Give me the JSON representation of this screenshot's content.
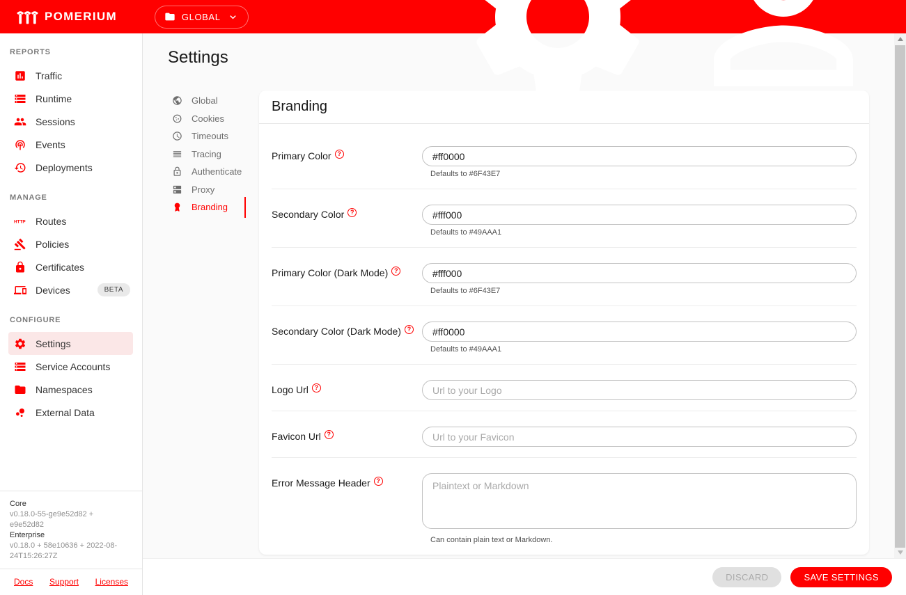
{
  "topbar": {
    "brand": "POMERIUM",
    "scope": {
      "label": "GLOBAL",
      "icon": "folder-icon",
      "chevron": "chevron-down-icon"
    },
    "actions": [
      {
        "name": "console-settings",
        "icon": "gear-icon"
      },
      {
        "name": "account",
        "icon": "person-icon"
      }
    ]
  },
  "colors": {
    "accent": "#ff0000",
    "topbar_bg": "#ff0000",
    "selected_item_bg": "#fbe7e7"
  },
  "sidebar": {
    "sections": [
      {
        "label": "REPORTS",
        "items": [
          {
            "label": "Traffic",
            "icon": "traffic-icon"
          },
          {
            "label": "Runtime",
            "icon": "runtime-icon"
          },
          {
            "label": "Sessions",
            "icon": "sessions-icon"
          },
          {
            "label": "Events",
            "icon": "events-icon"
          },
          {
            "label": "Deployments",
            "icon": "deployments-icon"
          }
        ]
      },
      {
        "label": "MANAGE",
        "items": [
          {
            "label": "Routes",
            "icon": "routes-icon"
          },
          {
            "label": "Policies",
            "icon": "policies-icon"
          },
          {
            "label": "Certificates",
            "icon": "certificates-icon"
          },
          {
            "label": "Devices",
            "icon": "devices-icon",
            "badge": "BETA"
          }
        ]
      },
      {
        "label": "CONFIGURE",
        "items": [
          {
            "label": "Settings",
            "icon": "settings-icon",
            "active": true
          },
          {
            "label": "Service Accounts",
            "icon": "service-accounts-icon"
          },
          {
            "label": "Namespaces",
            "icon": "namespaces-icon"
          },
          {
            "label": "External Data",
            "icon": "external-data-icon"
          }
        ]
      }
    ],
    "version": {
      "core_label": "Core",
      "core_value": "v0.18.0-55-ge9e52d82 + e9e52d82",
      "enterprise_label": "Enterprise",
      "enterprise_value": "v0.18.0 + 58e10636 + 2022-08-24T15:26:27Z"
    },
    "links": [
      {
        "label": "Docs"
      },
      {
        "label": "Support"
      },
      {
        "label": "Licenses"
      }
    ]
  },
  "main": {
    "title": "Settings",
    "subnav": [
      {
        "label": "Global",
        "icon": "globe-icon"
      },
      {
        "label": "Cookies",
        "icon": "cookies-icon"
      },
      {
        "label": "Timeouts",
        "icon": "timeouts-icon"
      },
      {
        "label": "Tracing",
        "icon": "tracing-icon"
      },
      {
        "label": "Authenticate",
        "icon": "authenticate-icon"
      },
      {
        "label": "Proxy",
        "icon": "proxy-icon"
      },
      {
        "label": "Branding",
        "icon": "branding-icon",
        "active": true
      }
    ],
    "card": {
      "title": "Branding",
      "fields": [
        {
          "label": "Primary Color",
          "value": "#ff0000",
          "helper": "Defaults to #6F43E7",
          "type": "text"
        },
        {
          "label": "Secondary Color",
          "value": "#fff000",
          "helper": "Defaults to #49AAA1",
          "type": "text"
        },
        {
          "label": "Primary Color (Dark Mode)",
          "value": "#fff000",
          "helper": "Defaults to #6F43E7",
          "type": "text"
        },
        {
          "label": "Secondary Color (Dark Mode)",
          "value": "#ff0000",
          "helper": "Defaults to #49AAA1",
          "type": "text"
        },
        {
          "label": "Logo Url",
          "placeholder": "Url to your Logo",
          "type": "text"
        },
        {
          "label": "Favicon Url",
          "placeholder": "Url to your Favicon",
          "type": "text"
        },
        {
          "label": "Error Message Header",
          "placeholder": "Plaintext or Markdown",
          "helper": "Can contain plain text or Markdown.",
          "type": "textarea"
        }
      ]
    },
    "footer": {
      "discard_label": "DISCARD",
      "save_label": "SAVE SETTINGS"
    }
  }
}
